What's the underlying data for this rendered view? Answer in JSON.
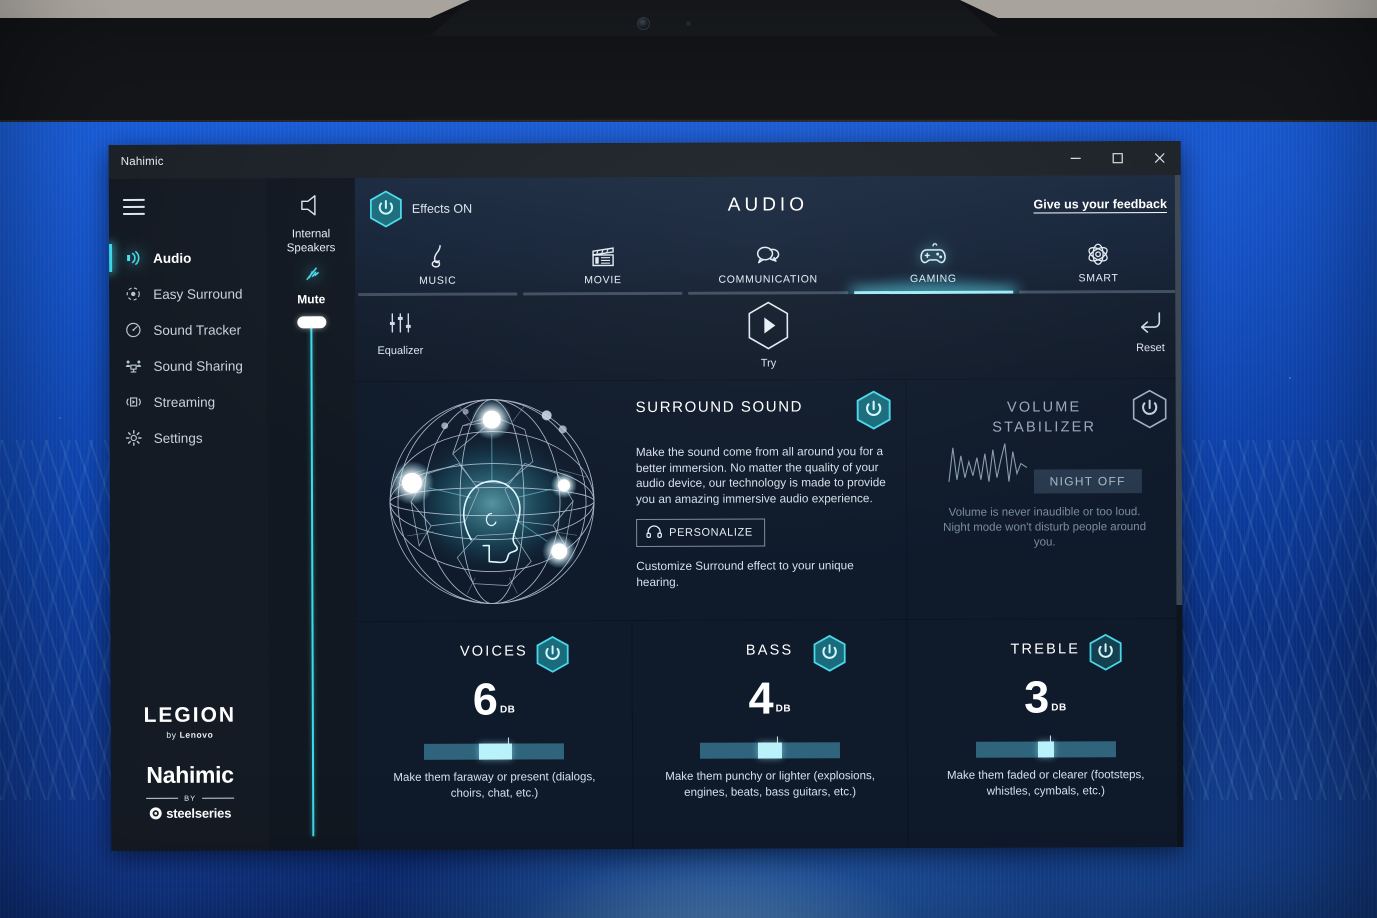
{
  "window": {
    "title": "Nahimic",
    "controls": {
      "minimize": "–",
      "maximize": "☐",
      "close": "✕"
    }
  },
  "sidebar": {
    "menu_icon": "hamburger-icon",
    "items": [
      {
        "label": "Audio",
        "icon": "sound-waves-icon",
        "active": true
      },
      {
        "label": "Easy Surround",
        "icon": "surround-target-icon",
        "active": false
      },
      {
        "label": "Sound Tracker",
        "icon": "radar-dial-icon",
        "active": false
      },
      {
        "label": "Sound Sharing",
        "icon": "people-share-icon",
        "active": false
      },
      {
        "label": "Streaming",
        "icon": "streaming-icon",
        "active": false
      },
      {
        "label": "Settings",
        "icon": "gear-icon",
        "active": false
      }
    ],
    "brand": {
      "legion": "LEGION",
      "legion_by": "by",
      "legion_lenovo": "Lenovo",
      "nahimic": "Nahimic",
      "by": "BY",
      "steelseries": "steelseries"
    }
  },
  "device": {
    "speaker_icon": "speaker-icon",
    "name_line1": "Internal",
    "name_line2": "Speakers",
    "mute_icon": "mute-icon",
    "mute_label": "Mute",
    "volume_percent": 100
  },
  "header": {
    "effects_toggle_icon": "power-icon",
    "effects_label": "Effects ON",
    "title": "AUDIO",
    "feedback_link": "Give us your feedback"
  },
  "tabs": [
    {
      "label": "MUSIC",
      "icon": "music-note-icon",
      "active": false
    },
    {
      "label": "MOVIE",
      "icon": "clapperboard-icon",
      "active": false
    },
    {
      "label": "COMMUNICATION",
      "icon": "speech-bubbles-icon",
      "active": false
    },
    {
      "label": "GAMING",
      "icon": "gamepad-icon",
      "active": true
    },
    {
      "label": "SMART",
      "icon": "atom-icon",
      "active": false
    }
  ],
  "toolbar": {
    "equalizer_label": "Equalizer",
    "equalizer_icon": "sliders-icon",
    "try_label": "Try",
    "try_icon": "play-icon",
    "reset_label": "Reset",
    "reset_icon": "undo-arrow-icon"
  },
  "surround": {
    "title": "SURROUND SOUND",
    "power_icon": "power-icon",
    "power_state": "on",
    "description": "Make the sound come from all around you for a better immersion. No matter the quality of your audio device, our technology is made to provide you an amazing immersive audio experience.",
    "personalize_label": "PERSONALIZE",
    "personalize_icon": "headphones-icon",
    "note": "Customize Surround effect to your unique hearing.",
    "visual": "geodesic-sphere-with-head-profile"
  },
  "volume_stabilizer": {
    "title_line1": "VOLUME",
    "title_line2": "STABILIZER",
    "power_icon": "power-icon",
    "power_state": "off",
    "waveform_icon": "waveform-icon",
    "night_button": "NIGHT OFF",
    "note": "Volume is never inaudible or too loud. Night mode won't disturb people around you."
  },
  "equalizers": [
    {
      "title": "VOICES",
      "power_icon": "power-icon",
      "power_state": "on",
      "value": "6",
      "unit": "DB",
      "slider_percent": 62,
      "description": "Make them faraway or present (dialogs, choirs, chat, etc.)"
    },
    {
      "title": "BASS",
      "power_icon": "power-icon",
      "power_state": "on",
      "value": "4",
      "unit": "DB",
      "slider_percent": 52,
      "description": "Make them punchy or lighter (explosions, engines, beats, bass guitars, etc.)"
    },
    {
      "title": "TREBLE",
      "power_icon": "power-icon",
      "power_state": "on",
      "value": "3",
      "unit": "DB",
      "slider_percent": 50,
      "description": "Make them faded or clearer (footsteps, whistles, cymbals, etc.)"
    }
  ],
  "colors": {
    "accent_cyan": "#3fd9e8",
    "panel_bg": "#0f1a2b",
    "sidebar_bg": "#151b24",
    "slider_fill": "#b9f2fb",
    "slider_track": "#2f647c",
    "disabled_text": "#7b8ca0"
  }
}
